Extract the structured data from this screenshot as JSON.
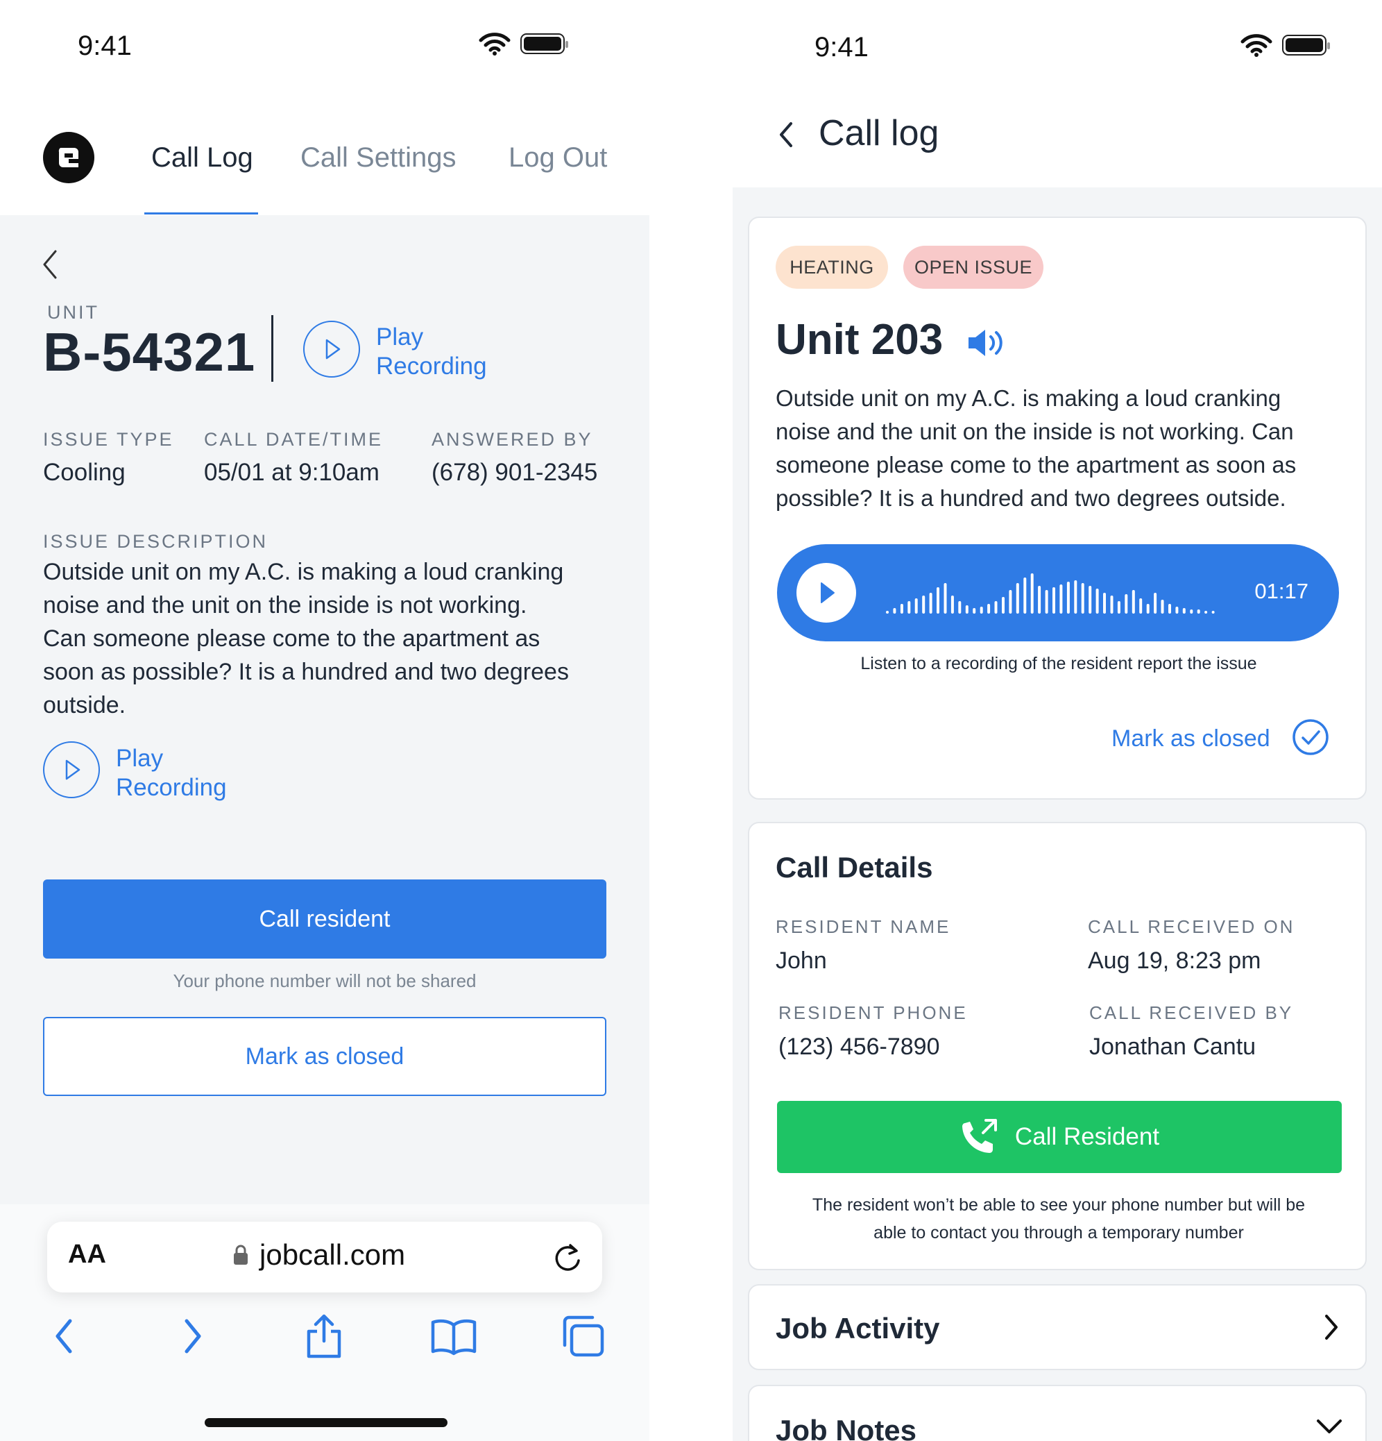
{
  "left": {
    "status": {
      "time": "9:41"
    },
    "nav": {
      "tabs": [
        "Call Log",
        "Call Settings",
        "Log Out"
      ]
    },
    "unit_label": "UNIT",
    "unit_value": "B-54321",
    "play_recording": [
      "Play",
      "Recording"
    ],
    "fields": [
      {
        "label": "ISSUE TYPE",
        "value": "Cooling"
      },
      {
        "label": "CALL DATE/TIME",
        "value": "05/01 at 9:10am"
      },
      {
        "label": "ANSWERED BY",
        "value": "(678) 901-2345"
      }
    ],
    "issue_description_label": "ISSUE DESCRIPTION",
    "issue_description_lines": [
      "Outside unit on my A.C. is making a loud cranking",
      "noise and the unit on the inside is not working.",
      "Can someone please come to the apartment as",
      "soon as possible? It is a hundred and two degrees",
      "outside."
    ],
    "call_resident_label": "Call resident",
    "privacy_note": "Your phone number will not be shared",
    "mark_closed_label": "Mark as closed",
    "browser": {
      "text_size": "AA",
      "url": "jobcall.com"
    }
  },
  "right": {
    "status": {
      "time": "9:41"
    },
    "header_title": "Call log",
    "tags": [
      {
        "label": "HEATING",
        "color": "#fde3cf"
      },
      {
        "label": "OPEN ISSUE",
        "color": "#f8c9c9"
      }
    ],
    "unit_title": "Unit 203",
    "description_lines": [
      "Outside unit on my A.C. is making a loud cranking",
      "noise and the unit on the inside is not working. Can",
      "someone please come to the apartment as soon as",
      "possible? It is a hundred and two degrees outside."
    ],
    "audio": {
      "duration": "01:17",
      "caption": "Listen to a recording of the resident report the issue"
    },
    "mark_closed_label": "Mark as closed",
    "call_details": {
      "title": "Call Details",
      "fields": [
        {
          "label": "RESIDENT NAME",
          "value": "John"
        },
        {
          "label": "CALL RECEIVED ON",
          "value": "Aug 19, 8:23 pm"
        },
        {
          "label": "RESIDENT PHONE",
          "value": "(123) 456-7890"
        },
        {
          "label": "CALL RECEIVED BY",
          "value": "Jonathan Cantu"
        }
      ],
      "call_button_label": "Call Resident",
      "note_lines": [
        "The resident won’t be able to see your phone number but will be",
        "able to contact you through a temporary number"
      ]
    },
    "job_activity_title": "Job Activity",
    "job_notes_title": "Job Notes"
  },
  "colors": {
    "accent": "#2f7be5",
    "success": "#1ec465",
    "background": "#f3f5f7"
  }
}
